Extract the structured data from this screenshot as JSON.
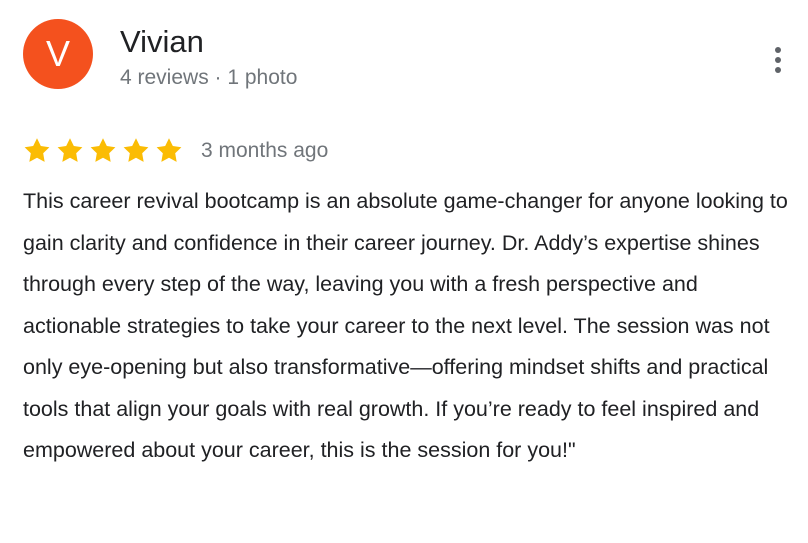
{
  "reviewer": {
    "avatar_letter": "V",
    "avatar_color": "#f4511e",
    "name": "Vivian",
    "meta": "4 reviews · 1 photo"
  },
  "actions": {
    "more_icon": "more-vert-icon"
  },
  "review": {
    "rating": 5,
    "max_rating": 5,
    "star_color": "#fbbc04",
    "date": "3 months ago",
    "text": "This career revival bootcamp is an absolute game-changer for anyone looking to gain clarity and confidence in their career journey. Dr. Addy’s expertise shines through every step of the way, leaving you with a fresh perspective and actionable strategies to take your career to the next level. The session was not only eye-opening but also transformative—offering mindset shifts and practical tools that align your goals with real growth. If you’re ready to feel inspired and empowered about your career, this is the session for you!\""
  }
}
